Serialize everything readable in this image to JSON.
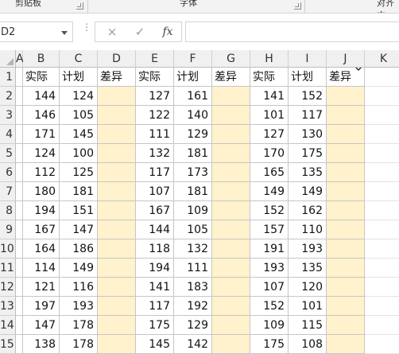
{
  "ribbon": {
    "groups": [
      {
        "label": "剪贴板"
      },
      {
        "label": "字体"
      },
      {
        "label": "对齐方"
      }
    ]
  },
  "formula_bar": {
    "name_box": "D2",
    "cancel_symbol": "×",
    "enter_symbol": "✓",
    "fx_symbol": "fx",
    "formula": ""
  },
  "grid": {
    "column_headers": [
      "A",
      "B",
      "C",
      "D",
      "E",
      "F",
      "G",
      "H",
      "I",
      "J",
      "K"
    ],
    "row_headers": [
      "1",
      "2",
      "3",
      "4",
      "5",
      "6",
      "7",
      "8",
      "9",
      "10",
      "11",
      "12",
      "13",
      "14",
      "15"
    ],
    "header_row": [
      "实际",
      "计划",
      "差异",
      "实际",
      "计划",
      "差异",
      "实际",
      "计划",
      "差异"
    ],
    "rows": [
      [
        "144",
        "124",
        "",
        "127",
        "161",
        "",
        "141",
        "152",
        ""
      ],
      [
        "146",
        "105",
        "",
        "122",
        "140",
        "",
        "101",
        "117",
        ""
      ],
      [
        "171",
        "145",
        "",
        "111",
        "129",
        "",
        "127",
        "130",
        ""
      ],
      [
        "124",
        "100",
        "",
        "132",
        "181",
        "",
        "170",
        "175",
        ""
      ],
      [
        "112",
        "125",
        "",
        "117",
        "173",
        "",
        "165",
        "135",
        ""
      ],
      [
        "180",
        "181",
        "",
        "107",
        "181",
        "",
        "149",
        "149",
        ""
      ],
      [
        "194",
        "151",
        "",
        "167",
        "109",
        "",
        "152",
        "162",
        ""
      ],
      [
        "167",
        "147",
        "",
        "144",
        "105",
        "",
        "157",
        "110",
        ""
      ],
      [
        "164",
        "186",
        "",
        "118",
        "132",
        "",
        "191",
        "193",
        ""
      ],
      [
        "114",
        "149",
        "",
        "194",
        "111",
        "",
        "193",
        "135",
        ""
      ],
      [
        "121",
        "116",
        "",
        "141",
        "183",
        "",
        "107",
        "120",
        ""
      ],
      [
        "197",
        "193",
        "",
        "117",
        "192",
        "",
        "152",
        "101",
        ""
      ],
      [
        "147",
        "178",
        "",
        "175",
        "129",
        "",
        "109",
        "115",
        ""
      ],
      [
        "138",
        "178",
        "",
        "145",
        "142",
        "",
        "175",
        "108",
        ""
      ]
    ],
    "diff_fill_color": "#fff2cc"
  }
}
